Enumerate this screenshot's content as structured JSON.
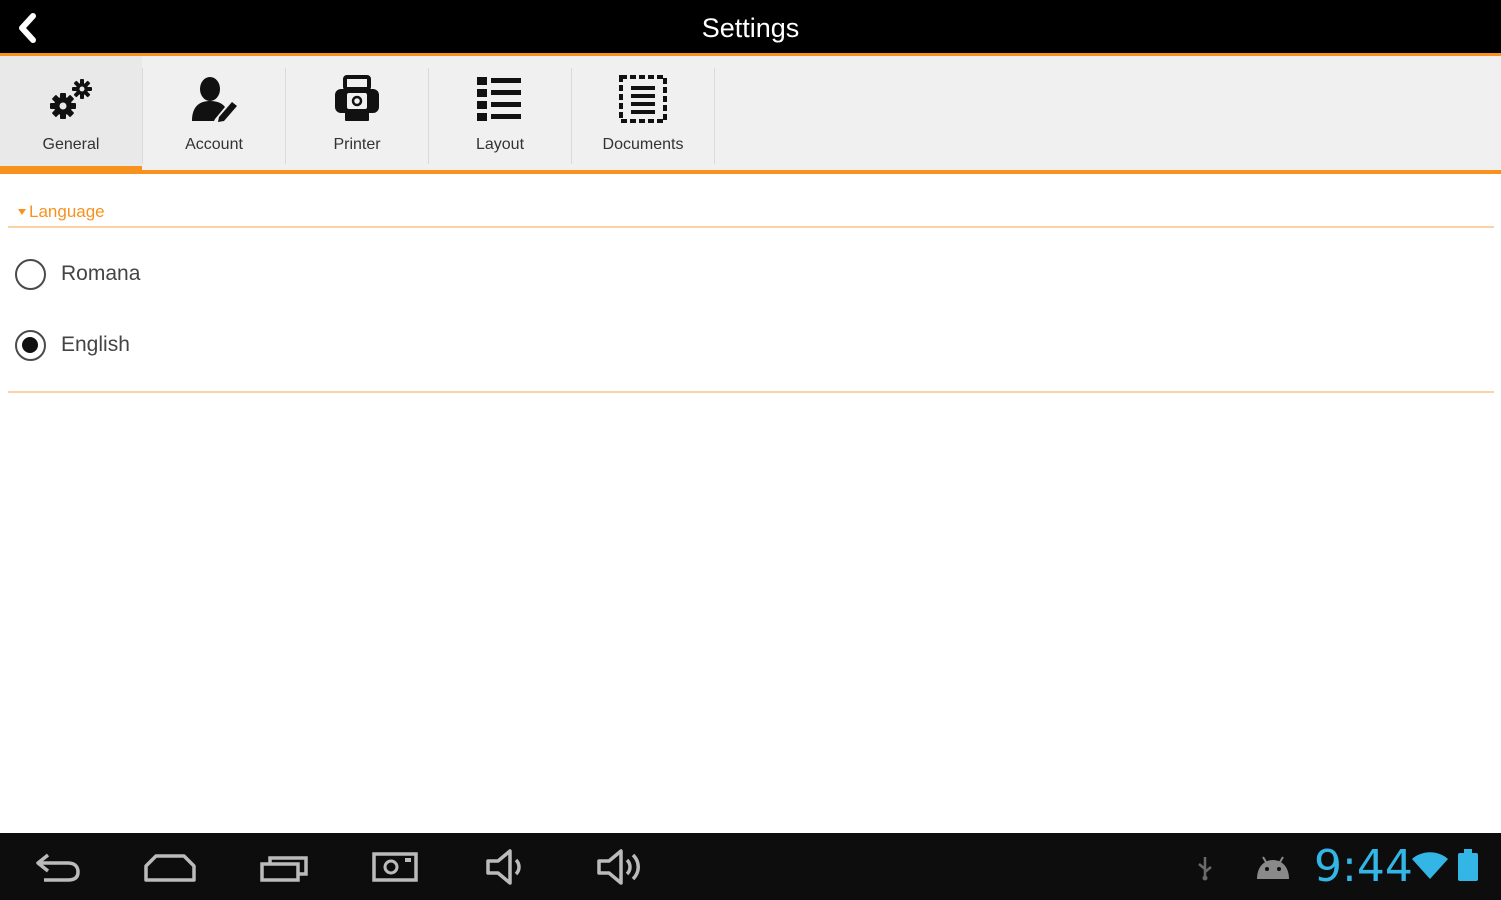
{
  "app": {
    "title": "Settings",
    "accent_color": "#f7921e"
  },
  "tabs": [
    {
      "label": "General",
      "icon": "gears-icon",
      "active": true
    },
    {
      "label": "Account",
      "icon": "user-edit-icon",
      "active": false
    },
    {
      "label": "Printer",
      "icon": "printer-icon",
      "active": false
    },
    {
      "label": "Layout",
      "icon": "list-icon",
      "active": false
    },
    {
      "label": "Documents",
      "icon": "document-icon",
      "active": false
    }
  ],
  "language_section": {
    "header": "Language",
    "options": [
      {
        "label": "Romana",
        "selected": false
      },
      {
        "label": "English",
        "selected": true
      }
    ]
  },
  "system_bar": {
    "time": "9:44",
    "clock_color": "#33b5e5",
    "buttons": [
      "back-icon",
      "home-icon",
      "recent-apps-icon",
      "screenshot-icon",
      "volume-down-icon",
      "volume-up-icon"
    ],
    "status_icons": [
      "usb-icon",
      "android-debug-icon",
      "wifi-icon",
      "battery-icon"
    ]
  }
}
